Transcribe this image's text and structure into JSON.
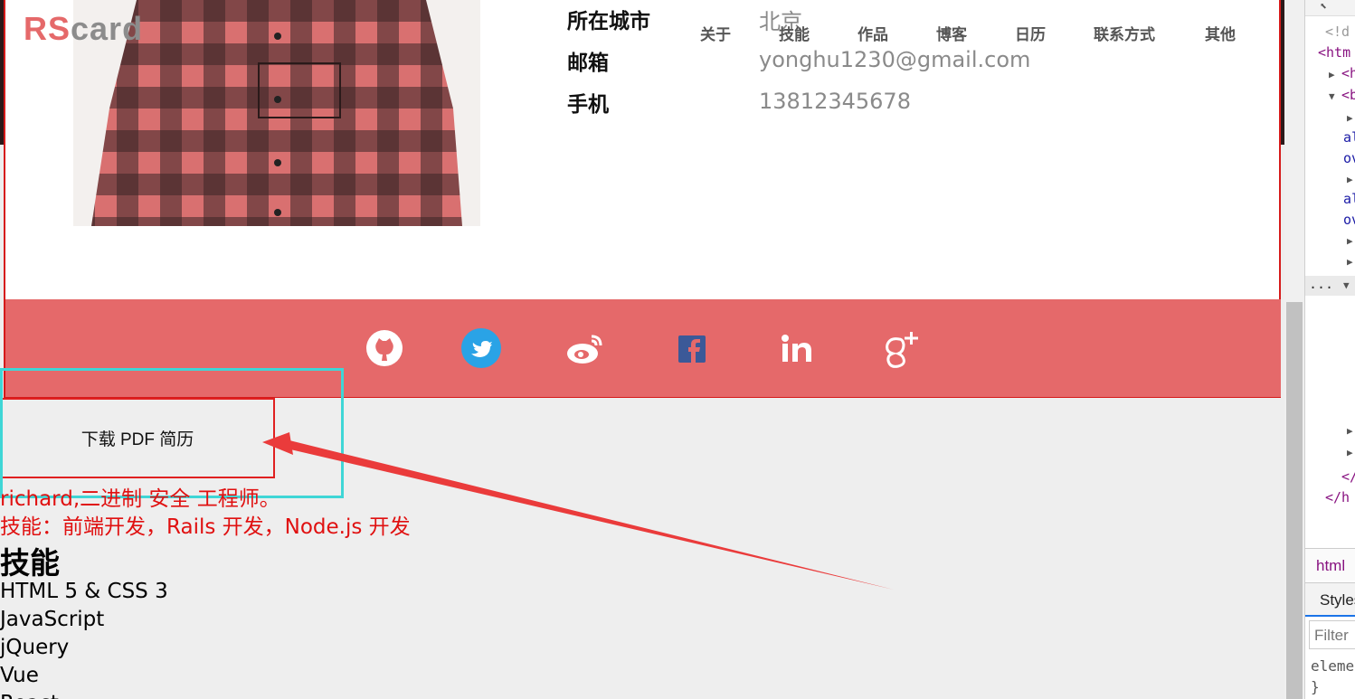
{
  "header": {
    "logo_rs": "RS",
    "logo_card": "card",
    "nav": [
      "关于",
      "技能",
      "作品",
      "博客",
      "日历",
      "联系方式",
      "其他"
    ]
  },
  "profile": {
    "city_label": "所在城市",
    "city_value": "北京",
    "email_label": "邮箱",
    "email_value": "yonghu1230@gmail.com",
    "phone_label": "手机",
    "phone_value": "13812345678"
  },
  "social": [
    "github-icon",
    "twitter-icon",
    "weibo-icon",
    "facebook-icon",
    "linkedin-icon",
    "google-plus-icon"
  ],
  "download": {
    "label": "下载 PDF 简历"
  },
  "intro": {
    "line1": "richard,二进制 安全 工程师。",
    "line2": "技能：前端开发，Rails 开发，Node.js 开发"
  },
  "skills": {
    "heading": "技能",
    "items": [
      "HTML 5 & CSS 3",
      "JavaScript",
      "jQuery",
      "Vue",
      "React"
    ]
  },
  "devtools": {
    "lines": [
      "<!d",
      "<htm",
      "<h",
      "<b",
      "",
      "al",
      "ov",
      "",
      "al",
      "ov",
      "",
      "",
      "...",
      "",
      "",
      "",
      "",
      "",
      "",
      "",
      "</",
      "</h"
    ],
    "crumb": "html",
    "styles_tab": "Styles",
    "filter_placeholder": "Filter",
    "rule_line1": "eleme",
    "rule_line2": "}"
  },
  "colors": {
    "accent": "#e5696a",
    "annotation_red": "#e01010",
    "highlight_cyan": "#3fd6d6"
  }
}
